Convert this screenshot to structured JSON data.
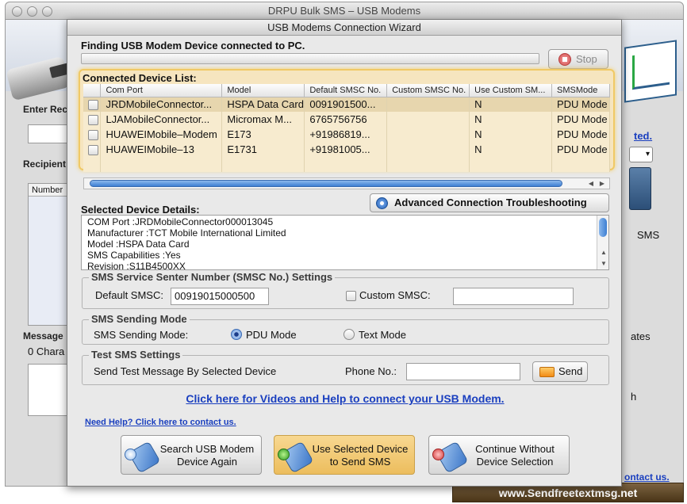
{
  "main_window": {
    "title": "DRPU Bulk SMS – USB Modems",
    "enter_rec_label": "Enter Rec",
    "recipient_label": "Recipient",
    "number_header": "Number",
    "message_label": "Message",
    "char_count": "0 Chara",
    "link_fragment": "ted.",
    "sms_fragment": "SMS",
    "ates_fragment": "ates",
    "h_fragment": "h",
    "contact_fragment": "ontact us.",
    "footer_site": "www.Sendfreetextmsg.net"
  },
  "dialog": {
    "title": "USB Modems Connection Wizard",
    "finding_text": "Finding USB Modem Device connected to PC.",
    "stop_label": "Stop",
    "device_list_label": "Connected Device List:",
    "columns": [
      "Com Port",
      "Model",
      "Default SMSC No.",
      "Custom SMSC No.",
      "Use Custom SM...",
      "SMSMode"
    ],
    "devices": [
      {
        "com_port": "JRDMobileConnector...",
        "model": "HSPA Data Card",
        "default_smsc": "0091901500...",
        "custom_smsc": "",
        "use_custom": "N",
        "sms_mode": "PDU Mode"
      },
      {
        "com_port": "LJAMobileConnector...",
        "model": "Micromax M...",
        "default_smsc": "6765756756",
        "custom_smsc": "",
        "use_custom": "N",
        "sms_mode": "PDU Mode"
      },
      {
        "com_port": "HUAWEIMobile–Modem",
        "model": "E173",
        "default_smsc": "+91986819...",
        "custom_smsc": "",
        "use_custom": "N",
        "sms_mode": "PDU Mode"
      },
      {
        "com_port": "HUAWEIMobile–13",
        "model": "E1731",
        "default_smsc": "+91981005...",
        "custom_smsc": "",
        "use_custom": "N",
        "sms_mode": "PDU Mode"
      }
    ],
    "advanced_button": "Advanced Connection Troubleshooting",
    "selected_details_label": "Selected Device Details:",
    "details_lines": [
      "COM Port :JRDMobileConnector000013045",
      "Manufacturer :TCT Mobile International Limited",
      "Model :HSPA Data Card",
      "SMS Capabilities :Yes",
      "Revision :S11B4500XX"
    ],
    "smsc_group": {
      "title": "SMS Service Senter Number (SMSC No.) Settings",
      "default_label": "Default SMSC:",
      "default_value": "00919015000500",
      "custom_label": "Custom SMSC:",
      "custom_value": ""
    },
    "mode_group": {
      "title": "SMS Sending Mode",
      "mode_label": "SMS Sending Mode:",
      "pdu_label": "PDU Mode",
      "text_label": "Text Mode",
      "selected": "PDU Mode"
    },
    "test_group": {
      "title": "Test SMS Settings",
      "send_test_label": "Send Test Message By Selected Device",
      "phone_label": "Phone No.:",
      "phone_value": "",
      "send_label": "Send"
    },
    "video_link": "Click here for Videos and Help to connect your USB Modem.",
    "need_help_link": "Need Help? Click here to contact us.",
    "buttons": {
      "search_again_l1": "Search USB Modem",
      "search_again_l2": "Device Again",
      "use_selected_l1": "Use Selected Device",
      "use_selected_l2": "to Send SMS",
      "continue_l1": "Continue Without",
      "continue_l2": "Device Selection"
    }
  },
  "colors": {
    "highlight_panel": "#f6e5bf",
    "highlight_border": "#f0c965",
    "link": "#1a3fbf",
    "footer": "#5a4220"
  }
}
